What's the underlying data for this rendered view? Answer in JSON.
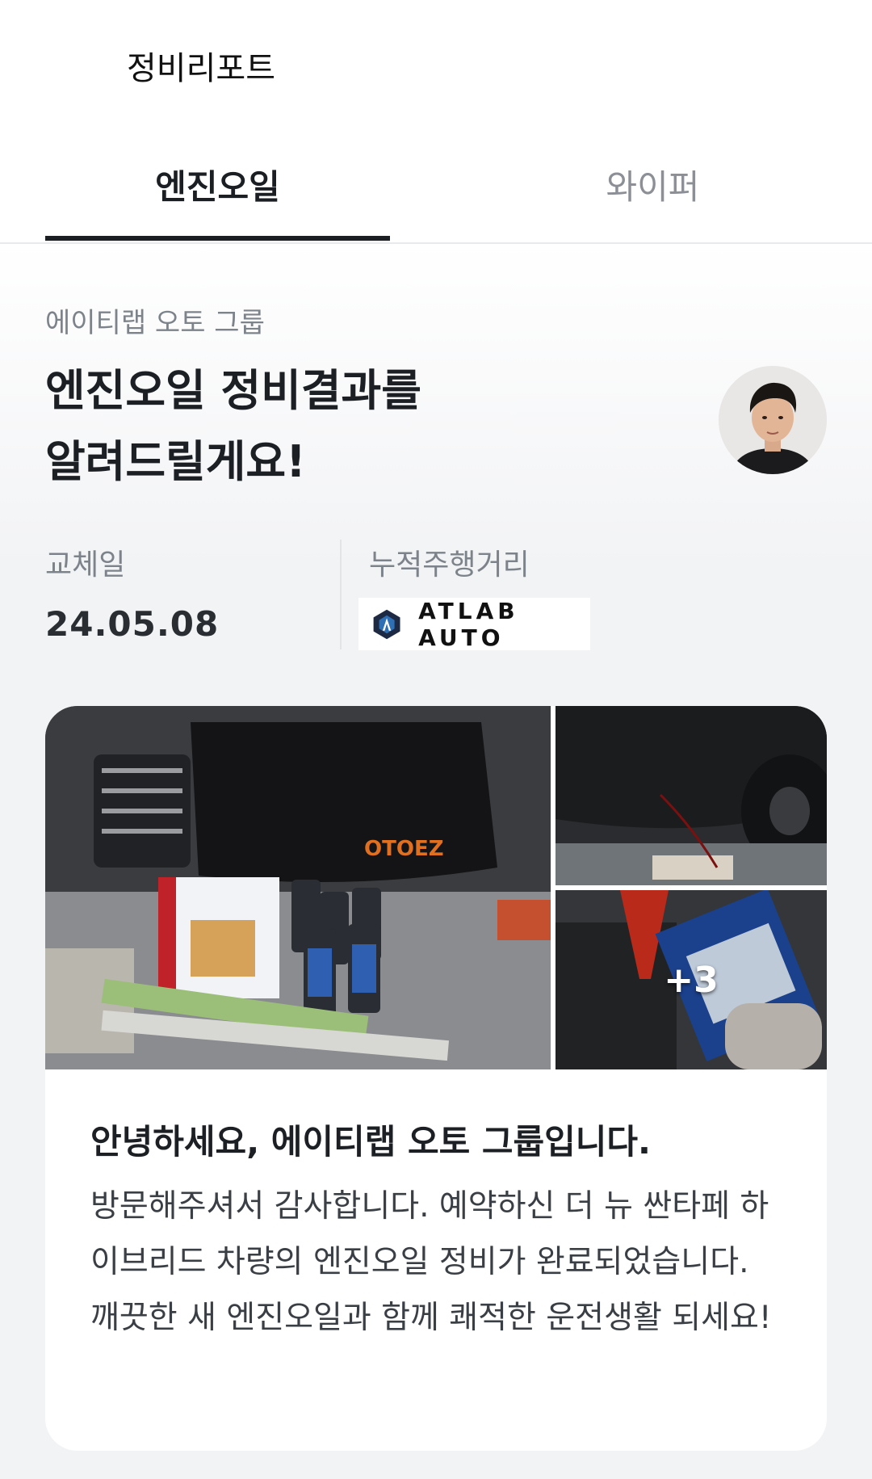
{
  "header": {
    "title": "정비리포트"
  },
  "tabs": [
    {
      "label": "엔진오일",
      "active": true
    },
    {
      "label": "와이퍼",
      "active": false
    }
  ],
  "report": {
    "shop_name": "에이티랩 오토 그룹",
    "headline_line1": "엔진오일 정비결과를",
    "headline_line2": "알려드릴게요!",
    "replacement_date_label": "교체일",
    "replacement_date": "24.05.08",
    "mileage_label": "누적주행거리",
    "brand_logo_text": "ATLAB AUTO"
  },
  "gallery": {
    "extra_count": "+3"
  },
  "message": {
    "title": "안녕하세요, 에이티랩 오토 그룹입니다.",
    "body": "방문해주셔서 감사합니다. 예약하신 더 뉴 싼타페 하이브리드 차량의 엔진오일 정비가 완료되었습니다. 깨끗한 새 엔진오일과 함께 쾌적한 운전생활 되세요!"
  },
  "colors": {
    "text_primary": "#1c1f23",
    "text_secondary": "#7d838a",
    "tab_inactive": "#8c9096",
    "brand_navy": "#1e2a44"
  }
}
